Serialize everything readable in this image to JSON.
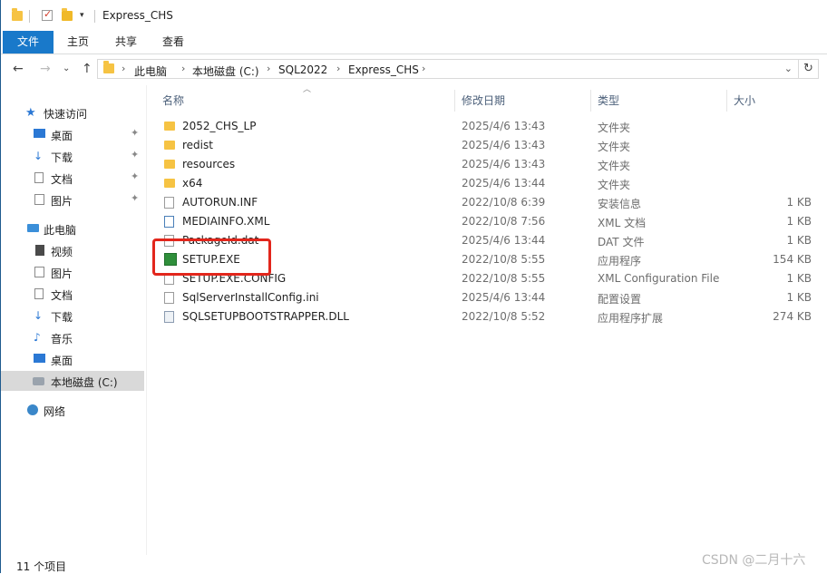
{
  "window": {
    "title": "Express_CHS"
  },
  "ribbon": {
    "tabs": [
      "文件",
      "主页",
      "共享",
      "查看"
    ]
  },
  "address": {
    "crumbs": [
      "此电脑",
      "本地磁盘 (C:)",
      "SQL2022",
      "Express_CHS"
    ],
    "sep": "›",
    "dropdown": "⌄",
    "refresh": "↻"
  },
  "nav_buttons": {
    "back": "←",
    "forward": "→",
    "recent": "⌄",
    "up": "↑"
  },
  "sidebar": {
    "quick_access": "快速访问",
    "pinned": [
      "桌面",
      "下载",
      "文档",
      "图片"
    ],
    "this_pc": "此电脑",
    "pc_items": [
      "视频",
      "图片",
      "文档",
      "下载",
      "音乐",
      "桌面",
      "本地磁盘 (C:)"
    ],
    "network": "网络",
    "pin_glyph": "📌"
  },
  "columns": {
    "name": "名称",
    "date": "修改日期",
    "type": "类型",
    "size": "大小"
  },
  "files": [
    {
      "name": "2052_CHS_LP",
      "date": "2025/4/6 13:43",
      "type": "文件夹",
      "size": "",
      "icon": "folder-icon"
    },
    {
      "name": "redist",
      "date": "2025/4/6 13:43",
      "type": "文件夹",
      "size": "",
      "icon": "folder-icon"
    },
    {
      "name": "resources",
      "date": "2025/4/6 13:43",
      "type": "文件夹",
      "size": "",
      "icon": "folder-icon"
    },
    {
      "name": "x64",
      "date": "2025/4/6 13:44",
      "type": "文件夹",
      "size": "",
      "icon": "folder-icon"
    },
    {
      "name": "AUTORUN.INF",
      "date": "2022/10/8 6:39",
      "type": "安装信息",
      "size": "1 KB",
      "icon": "setup-info-icon"
    },
    {
      "name": "MEDIAINFO.XML",
      "date": "2022/10/8 7:56",
      "type": "XML 文档",
      "size": "1 KB",
      "icon": "xml-icon"
    },
    {
      "name": "PackageId.dat",
      "date": "2025/4/6 13:44",
      "type": "DAT 文件",
      "size": "1 KB",
      "icon": "file-icon"
    },
    {
      "name": "SETUP.EXE",
      "date": "2022/10/8 5:55",
      "type": "应用程序",
      "size": "154 KB",
      "icon": "setup-exe-icon"
    },
    {
      "name": "SETUP.EXE.CONFIG",
      "date": "2022/10/8 5:55",
      "type": "XML Configuration File",
      "size": "1 KB",
      "icon": "config-icon"
    },
    {
      "name": "SqlServerInstallConfig.ini",
      "date": "2025/4/6 13:44",
      "type": "配置设置",
      "size": "1 KB",
      "icon": "ini-icon"
    },
    {
      "name": "SQLSETUPBOOTSTRAPPER.DLL",
      "date": "2022/10/8 5:52",
      "type": "应用程序扩展",
      "size": "274 KB",
      "icon": "dll-icon"
    }
  ],
  "status": {
    "count": "11 个项目"
  },
  "watermark": "CSDN @二月十六",
  "colors": {
    "accent": "#1979ca",
    "highlight": "#e2261c",
    "folder": "#f6c343"
  }
}
